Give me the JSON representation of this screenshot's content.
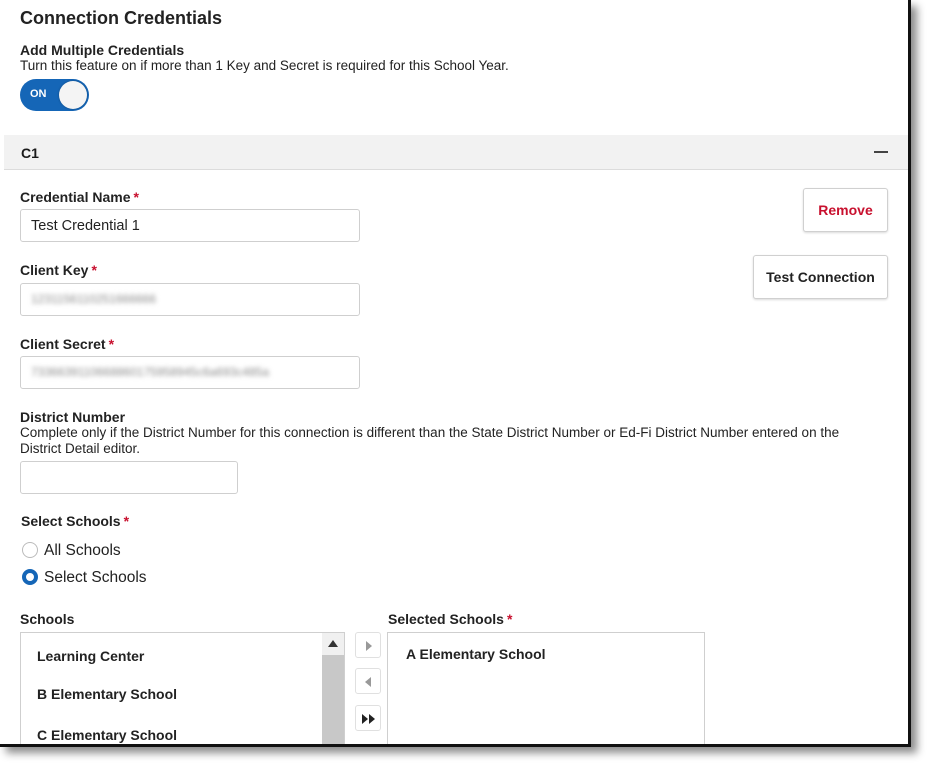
{
  "page": {
    "title": "Connection Credentials"
  },
  "multi": {
    "label": "Add Multiple Credentials",
    "description": "Turn this feature on if more than 1 Key and Secret is required for this School Year.",
    "toggle_text": "ON"
  },
  "section": {
    "title": "C1"
  },
  "credential_name": {
    "label": "Credential Name",
    "required": "*",
    "value": "Test Credential 1"
  },
  "client_key": {
    "label": "Client Key",
    "required": "*",
    "value": "1231156110251666666"
  },
  "client_secret": {
    "label": "Client Secret",
    "required": "*",
    "value": "7336639110668860175958945c6a693c485a"
  },
  "district_number": {
    "label": "District Number",
    "description": "Complete only if the District Number for this connection is different than the State District Number or Ed-Fi District Number entered on the District Detail editor.",
    "value": ""
  },
  "select_schools": {
    "label": "Select Schools",
    "required": "*",
    "options": [
      "All Schools",
      "Select Schools"
    ],
    "selected": "Select Schools"
  },
  "schools_list": {
    "label": "Schools",
    "items": [
      "Learning Center",
      "B Elementary School",
      "C Elementary School"
    ]
  },
  "selected_list": {
    "label": "Selected Schools",
    "required": "*",
    "items": [
      "A Elementary School"
    ]
  },
  "buttons": {
    "remove": "Remove",
    "test_connection": "Test Connection"
  },
  "colors": {
    "accent": "#1566b7",
    "required": "#c8102e",
    "remove_text": "#c8102e"
  }
}
